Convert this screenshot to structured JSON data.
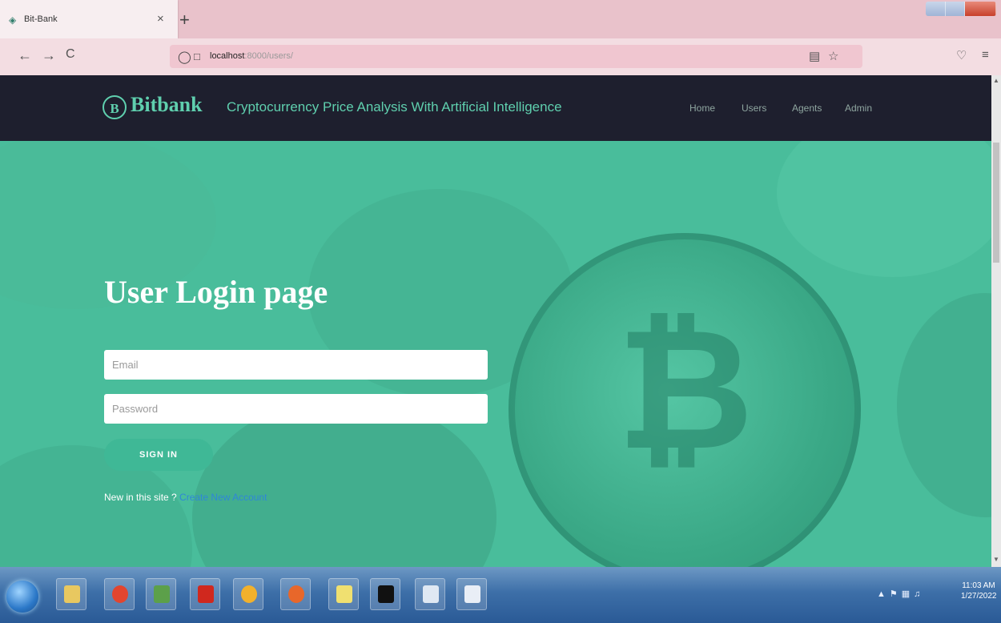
{
  "browser": {
    "tab_title": "Bit-Bank",
    "tab_close": "×",
    "new_tab": "+",
    "url_host": "localhost",
    "url_rest": ":8000/users/",
    "nav_back": "←",
    "nav_forward": "→",
    "nav_reload": "C"
  },
  "site": {
    "logo_mark": "B",
    "logo_text": "Bitbank",
    "tagline": "Cryptocurrency Price Analysis With Artificial Intelligence",
    "nav": [
      "Home",
      "Users",
      "Agents",
      "Admin"
    ]
  },
  "login": {
    "title": "User Login page",
    "email_placeholder": "Email",
    "password_placeholder": "Password",
    "signin_label": "SIGN IN",
    "new_text": "New in this site ? ",
    "create_link": "Create New Account"
  },
  "taskbar": {
    "time": "11:03 AM",
    "date": "1/27/2022"
  },
  "colors": {
    "accent": "#5fcfae",
    "hero_bg": "#49bd9b",
    "header_bg": "#1e1f2e",
    "link": "#2f86d8"
  }
}
